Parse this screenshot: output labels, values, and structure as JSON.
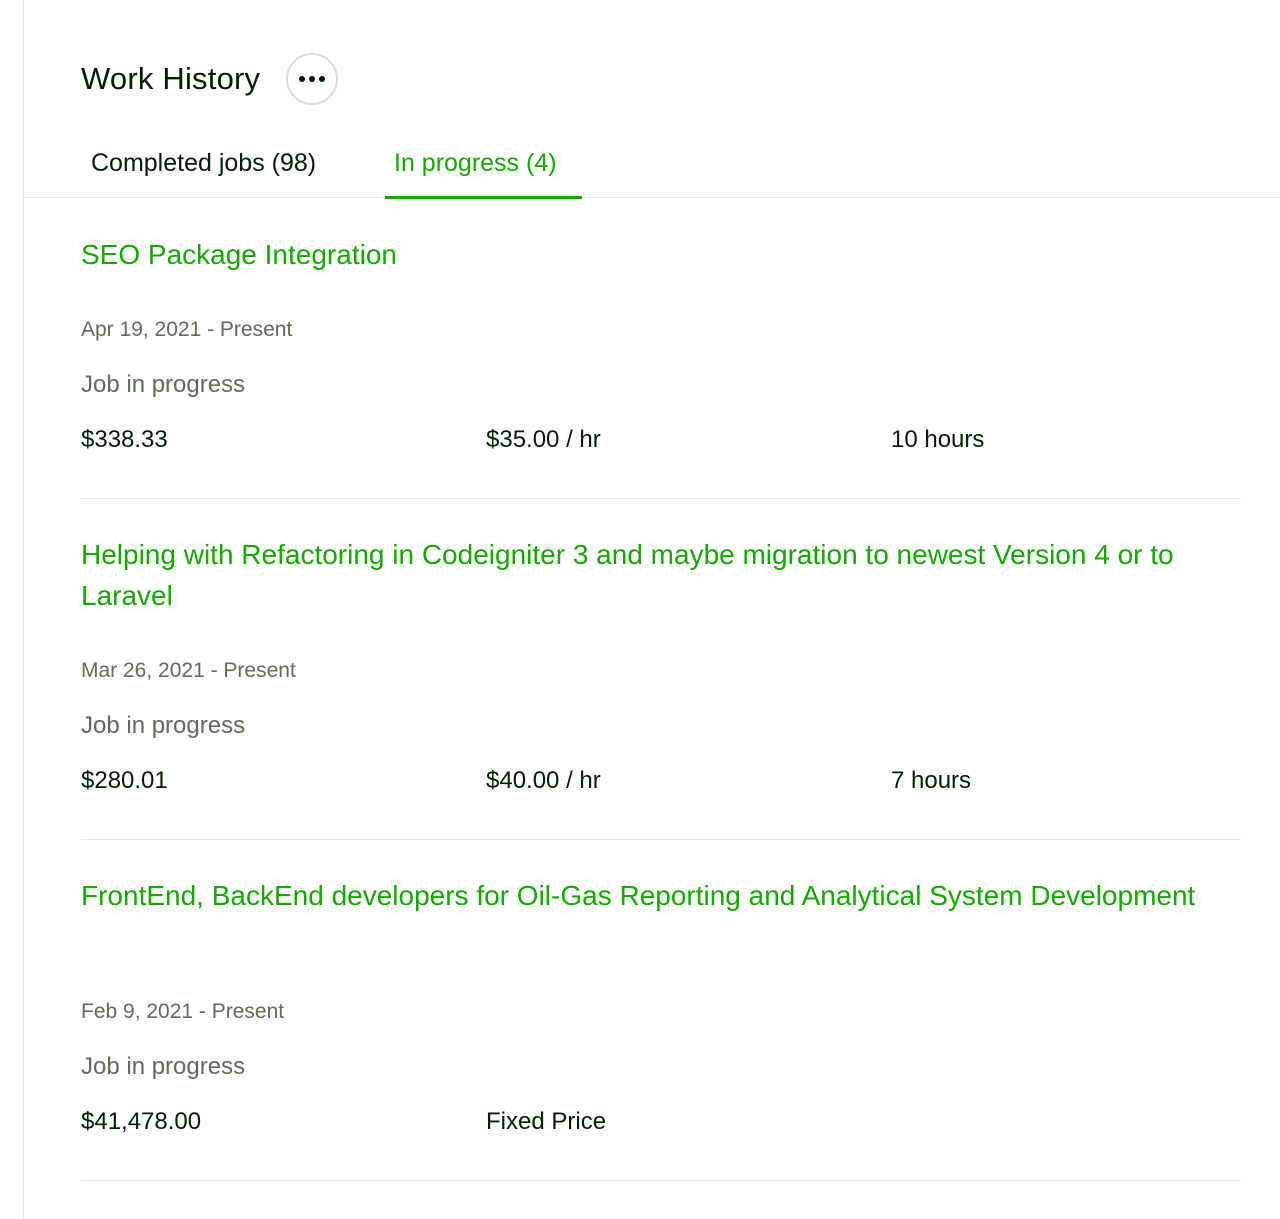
{
  "header": {
    "title": "Work History",
    "more_icon": "more-horizontal-icon"
  },
  "tabs": [
    {
      "label": "Completed jobs (98)",
      "active": false
    },
    {
      "label": "In progress (4)",
      "active": true
    }
  ],
  "colors": {
    "accent": "#14a800",
    "text": "#001e00",
    "muted": "#5e6d55",
    "divider": "#e4e5e7"
  },
  "jobs": [
    {
      "title": "SEO Package Integration",
      "date": "Apr 19, 2021 - Present",
      "status": "Job in progress",
      "earned": "$338.33",
      "rate": "$35.00 / hr",
      "hours": "10 hours"
    },
    {
      "title": "Helping with Refactoring in Codeigniter 3 and maybe migration to newest Version 4 or to Laravel",
      "date": "Mar 26, 2021 - Present",
      "status": "Job in progress",
      "earned": "$280.01",
      "rate": "$40.00 / hr",
      "hours": "7 hours"
    },
    {
      "title": "FrontEnd, BackEnd developers for Oil-Gas Reporting and Analytical System Development",
      "date": "Feb 9, 2021 - Present",
      "status": "Job in progress",
      "earned": "$41,478.00",
      "rate": "Fixed Price",
      "hours": ""
    }
  ]
}
